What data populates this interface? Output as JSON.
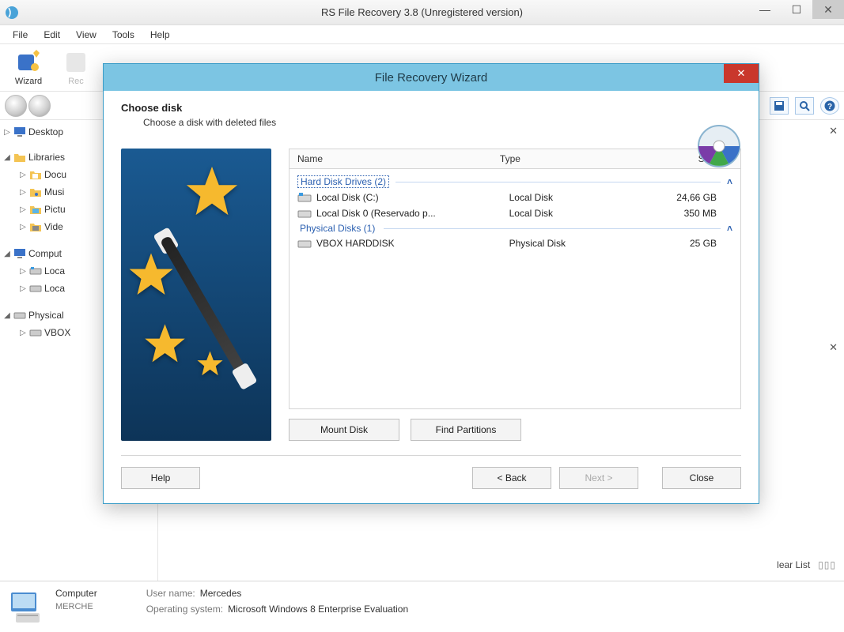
{
  "window": {
    "title": "RS File Recovery 3.8 (Unregistered version)"
  },
  "menu": {
    "file": "File",
    "edit": "Edit",
    "view": "View",
    "tools": "Tools",
    "help": "Help"
  },
  "toolbar": {
    "wizard": "Wizard",
    "recover": "Rec"
  },
  "tree": {
    "desktop": "Desktop",
    "libraries": "Libraries",
    "documents": "Docu",
    "music": "Musi",
    "pictures": "Pictu",
    "videos": "Vide",
    "computer": "Comput",
    "local1": "Loca",
    "local2": "Loca",
    "physical": "Physical",
    "vbox": "VBOX"
  },
  "wizard": {
    "title": "File Recovery Wizard",
    "heading": "Choose disk",
    "subheading": "Choose a disk with deleted files",
    "columns": {
      "name": "Name",
      "type": "Type",
      "size": "Size"
    },
    "group_hdd": "Hard Disk Drives (2)",
    "group_phys": "Physical Disks (1)",
    "disks": [
      {
        "name": "Local Disk (C:)",
        "type": "Local Disk",
        "size": "24,66 GB"
      },
      {
        "name": "Local Disk 0 (Reservado p...",
        "type": "Local Disk",
        "size": "350 MB"
      }
    ],
    "physical": [
      {
        "name": "VBOX HARDDISK",
        "type": "Physical Disk",
        "size": "25 GB"
      }
    ],
    "mount_disk": "Mount Disk",
    "find_partitions": "Find Partitions",
    "help": "Help",
    "back": "< Back",
    "next": "Next >",
    "close": "Close"
  },
  "status": {
    "computer_label": "Computer",
    "computer_name": "MERCHE",
    "username_label": "User name:",
    "username": "Mercedes",
    "os_label": "Operating system:",
    "os": "Microsoft Windows 8 Enterprise Evaluation",
    "clear_list": "lear List"
  }
}
